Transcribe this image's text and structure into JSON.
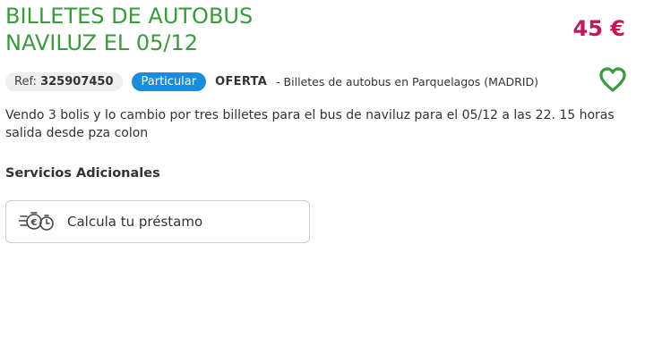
{
  "listing": {
    "title_line1": "BILLETES DE AUTOBUS",
    "title_line2": "NAVILUZ EL 05/12",
    "price": "45 €",
    "ref_label": "Ref:",
    "ref_number": "325907450",
    "seller_type": "Particular",
    "offer_type": "OFERTA",
    "location": "- Billetes de autobus en Parquelagos (MADRID)",
    "description": "Vendo 3 bolis y lo cambio por tres billetes para el bus de naviluz para el 05/12 a las 22. 15 horas salida desde pza colon"
  },
  "services": {
    "title": "Servicios Adicionales",
    "loan_label": "Calcula tu préstamo"
  },
  "icons": {
    "favorite": "heart-icon",
    "loan": "euro-clock-icon"
  },
  "colors": {
    "title": "#3b9a3e",
    "price": "#c2185b",
    "particular_badge": "#1a8cd8",
    "heart": "#3b9a3e"
  }
}
